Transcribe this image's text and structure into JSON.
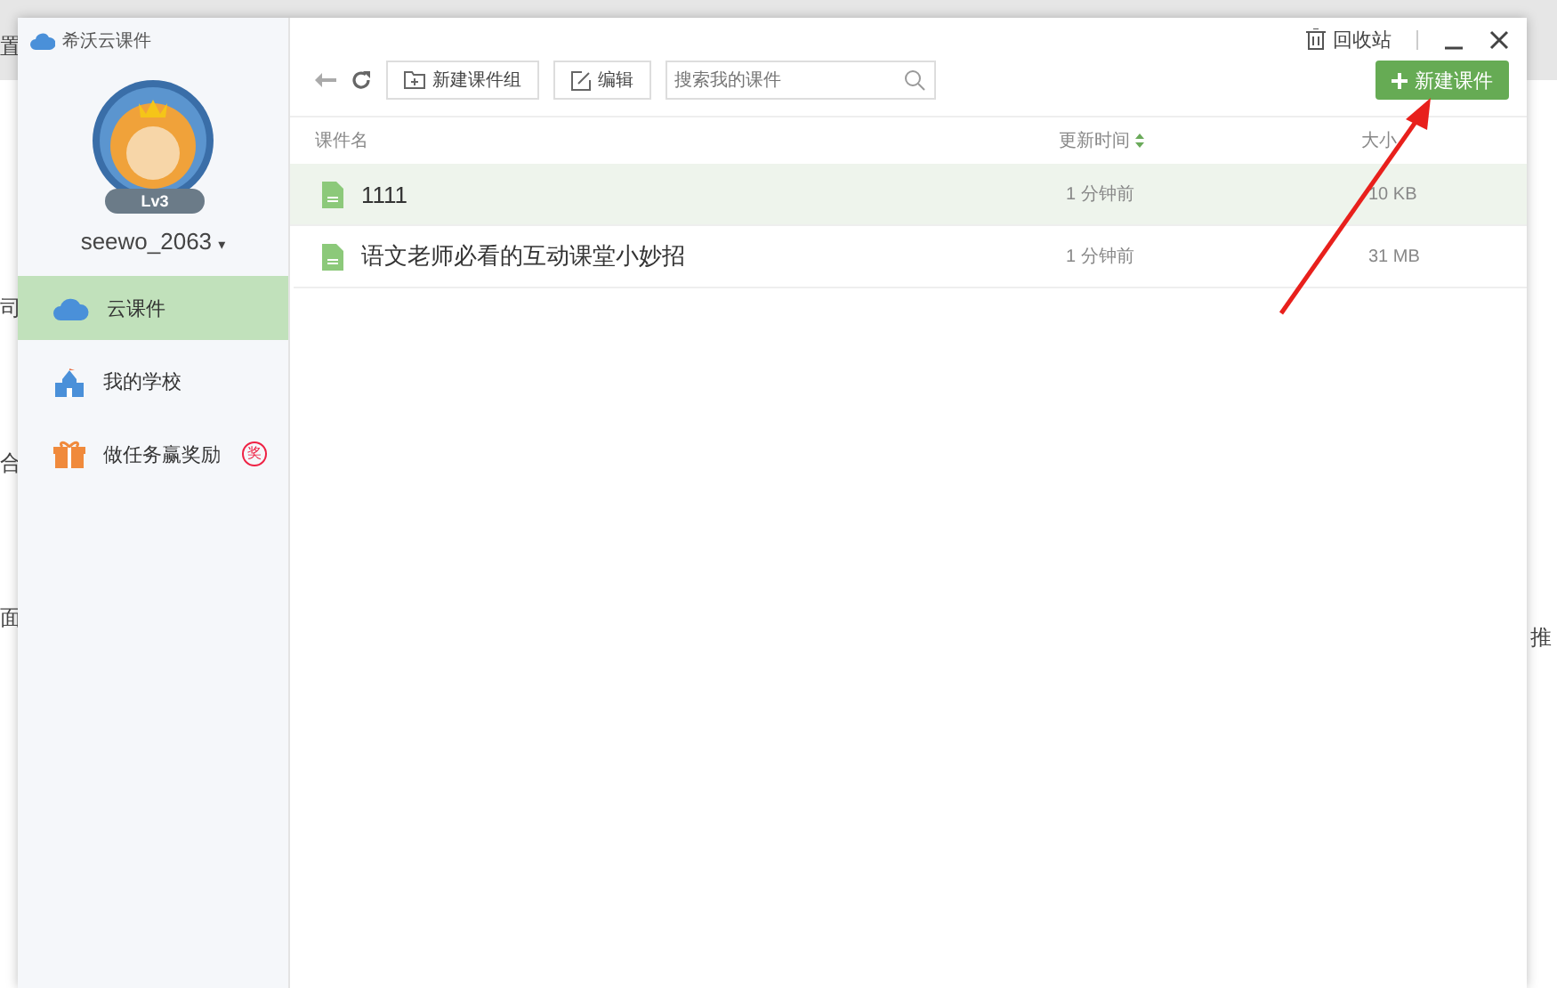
{
  "background_fragments": {
    "left": [
      "置",
      "司",
      "合",
      "面"
    ],
    "right": [
      "推"
    ]
  },
  "app": {
    "title": "希沃云课件",
    "user": {
      "level_badge": "Lv3",
      "name": "seewo_2063",
      "caret": "▾"
    },
    "nav": [
      {
        "kind": "cloud",
        "label": "云课件",
        "selected": true
      },
      {
        "kind": "school",
        "label": "我的学校",
        "selected": false
      },
      {
        "kind": "gift",
        "label": "做任务赢奖励",
        "selected": false,
        "badge": "奖"
      }
    ],
    "titlebar": {
      "recycle": "回收站"
    },
    "toolbar": {
      "new_group": "新建课件组",
      "edit": "编辑",
      "search_placeholder": "搜索我的课件",
      "new_course": "新建课件"
    },
    "table": {
      "columns": [
        "课件名",
        "更新时间",
        "大小"
      ],
      "rows": [
        {
          "name": "1111",
          "time": "1 分钟前",
          "size": "10 KB",
          "selected": true
        },
        {
          "name": "语文老师必看的互动课堂小妙招",
          "time": "1 分钟前",
          "size": "31 MB",
          "selected": false
        }
      ]
    }
  }
}
